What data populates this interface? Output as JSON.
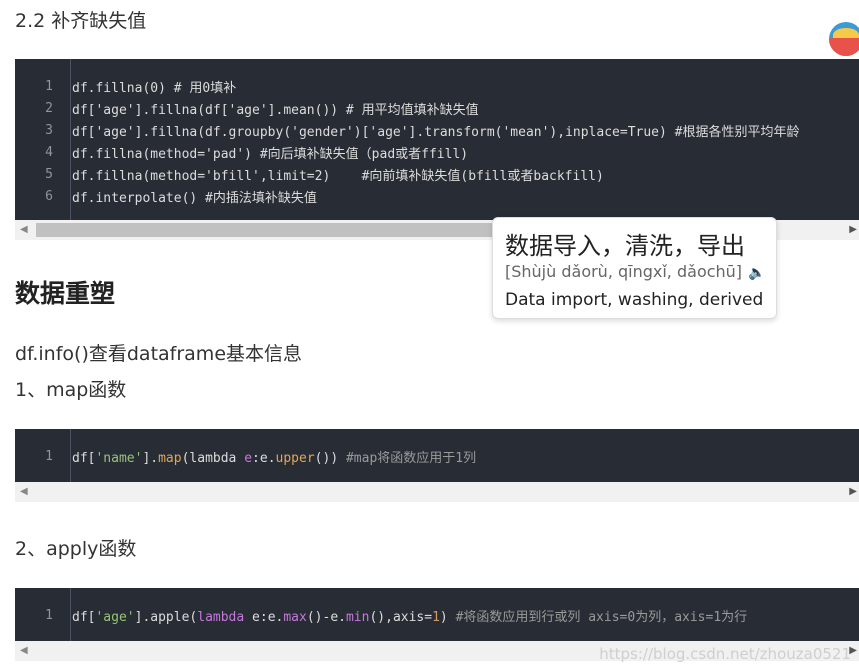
{
  "section_2_2": "2.2 补齐缺失值",
  "code1": {
    "line_numbers": [
      "1",
      "2",
      "3",
      "4",
      "5",
      "6"
    ]
  },
  "heading_reshape": "数据重塑",
  "p_info": "df.info()查看dataframe基本信息",
  "p_map": "1、map函数",
  "p_apply": "2、apply函数",
  "popup": {
    "word": "数据导入，清洗，导出",
    "pinyin": "[Shùjù dǎorù, qīngxǐ, dǎochū]",
    "translation": "Data import, washing, derived"
  },
  "watermark": "https://blog.csdn.net/zhouza0521"
}
